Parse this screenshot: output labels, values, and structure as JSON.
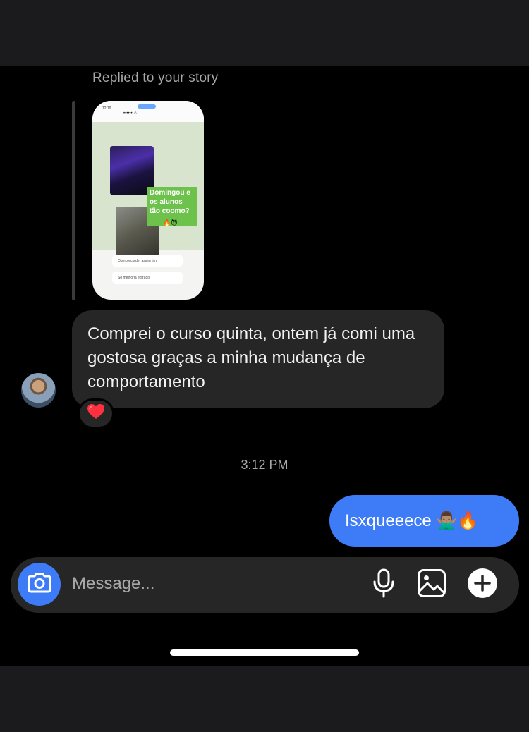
{
  "thread": {
    "replied_label": "Replied to your story",
    "story_preview": {
      "overlay_text": "Domingou e os alunos tão coomo?",
      "overlay_emojis": "🔥😈",
      "option_1": "Quero ecorder assim tim",
      "option_2": "So melhoria edtrago"
    },
    "incoming_message": "Comprei o curso quinta, ontem já comi uma gostosa graças a minha mudança de comportamento",
    "reaction": "❤️",
    "timestamp": "3:12 PM",
    "outgoing_message": "Isxqueeece 🙅🏽‍♂️🔥"
  },
  "composer": {
    "placeholder": "Message..."
  },
  "colors": {
    "accent_blue": "#3e7bf7",
    "incoming_bubble": "#262626",
    "background": "#000000",
    "secondary_text": "#a8a8a8"
  },
  "icons": {
    "camera": "camera-icon",
    "mic": "microphone-icon",
    "gallery": "image-icon",
    "add": "plus-circle-icon"
  }
}
